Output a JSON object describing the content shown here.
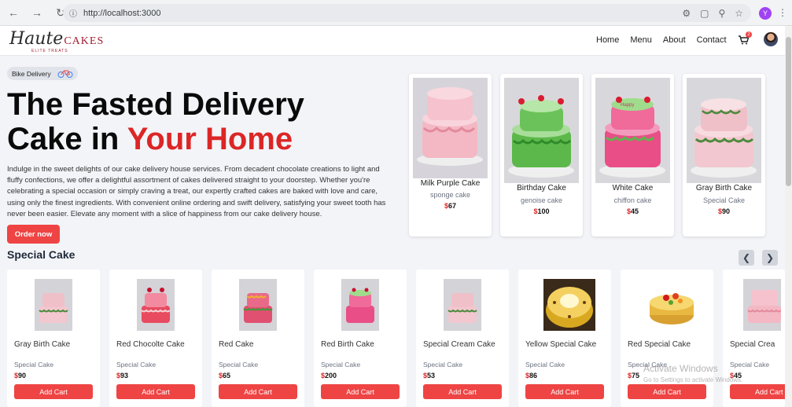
{
  "browser": {
    "url": "http://localhost:3000",
    "profile_initial": "Y"
  },
  "header": {
    "logo_main": "Haute",
    "logo_accent": "CAKES",
    "logo_sub": "ELITE TREATS",
    "nav": [
      "Home",
      "Menu",
      "About",
      "Contact"
    ],
    "cart_count": "2"
  },
  "hero": {
    "badge": "Bike Delivery",
    "title_line1": "The Fasted Delivery",
    "title_line2_plain": "Cake in ",
    "title_line2_accent": "Your Home",
    "description": "Indulge in the sweet delights of our cake delivery house services. From decadent chocolate creations to light and fluffy confections, we offer a delightful assortment of cakes delivered straight to your doorstep. Whether you're celebrating a special occasion or simply craving a treat, our expertly crafted cakes are baked with love and care, using only the finest ingredients. With convenient online ordering and swift delivery, satisfying your sweet tooth has never been easier. Elevate any moment with a slice of happiness from our cake delivery house.",
    "order_button": "Order now"
  },
  "featured": [
    {
      "name": "Milk Purple Cake",
      "category": "sponge cake",
      "currency": "$",
      "price": "67"
    },
    {
      "name": "Birthday Cake",
      "category": "genoise cake",
      "currency": "$",
      "price": "100"
    },
    {
      "name": "White Cake",
      "category": "chiffon cake",
      "currency": "$",
      "price": "45"
    },
    {
      "name": "Gray Birth Cake",
      "category": "Special Cake",
      "currency": "$",
      "price": "90"
    }
  ],
  "special": {
    "title": "Special Cake",
    "add_label": "Add Cart",
    "items": [
      {
        "name": "Gray Birth Cake",
        "category": "Special Cake",
        "currency": "$",
        "price": "90"
      },
      {
        "name": "Red Chocolte Cake",
        "category": "Special Cake",
        "currency": "$",
        "price": "93"
      },
      {
        "name": "Red Cake",
        "category": "Special Cake",
        "currency": "$",
        "price": "65"
      },
      {
        "name": "Red Birth Cake",
        "category": "Special Cake",
        "currency": "$",
        "price": "200"
      },
      {
        "name": "Special Cream Cake",
        "category": "Special Cake",
        "currency": "$",
        "price": "53"
      },
      {
        "name": "Yellow Special Cake",
        "category": "Special Cake",
        "currency": "$",
        "price": "86"
      },
      {
        "name": "Red Special Cake",
        "category": "Special Cake",
        "currency": "$",
        "price": "75"
      },
      {
        "name": "Special Crea",
        "category": "Special Cake",
        "currency": "$",
        "price": "45"
      }
    ]
  },
  "os_watermark": {
    "line1": "Activate Windows",
    "line2": "Go to Settings to activate Windows."
  }
}
